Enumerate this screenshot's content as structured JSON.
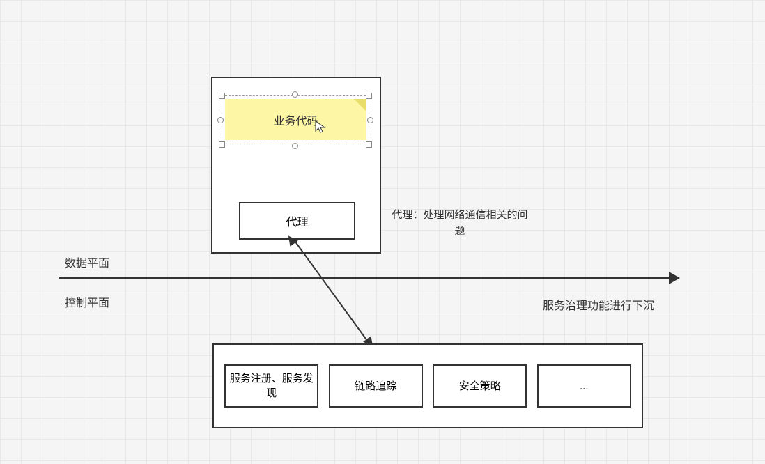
{
  "sticky": {
    "label": "业务代码"
  },
  "proxy": {
    "label": "代理",
    "desc": "代理：处理网络通信相关的问题"
  },
  "planes": {
    "data": "数据平面",
    "control": "控制平面"
  },
  "sub_label": "服务治理功能进行下沉",
  "services": {
    "box1": "服务注册、服务发现",
    "box2": "链路追踪",
    "box3": "安全策略",
    "box4": "..."
  }
}
